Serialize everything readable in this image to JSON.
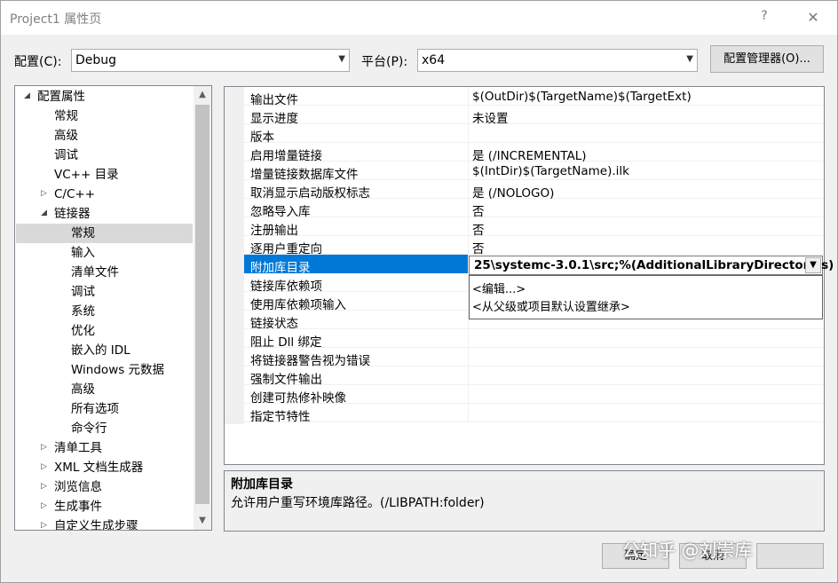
{
  "window": {
    "title": "Project1 属性页",
    "help_glyph": "?",
    "close_glyph": "✕"
  },
  "config": {
    "label": "配置(C):",
    "value": "Debug"
  },
  "platform": {
    "label": "平台(P):",
    "value": "x64"
  },
  "buttons": {
    "config_manager": "配置管理器(O)...",
    "ok": "确定",
    "cancel": "取消"
  },
  "tree": [
    {
      "label": "配置属性",
      "expander": "expanded"
    },
    {
      "label": "常规"
    },
    {
      "label": "高级"
    },
    {
      "label": "调试"
    },
    {
      "label": "VC++ 目录"
    },
    {
      "label": "C/C++",
      "expander": "collapsed"
    },
    {
      "label": "链接器",
      "expander": "expanded"
    },
    {
      "label": "常规",
      "selected": true
    },
    {
      "label": "输入"
    },
    {
      "label": "清单文件"
    },
    {
      "label": "调试"
    },
    {
      "label": "系统"
    },
    {
      "label": "优化"
    },
    {
      "label": "嵌入的 IDL"
    },
    {
      "label": "Windows 元数据"
    },
    {
      "label": "高级"
    },
    {
      "label": "所有选项"
    },
    {
      "label": "命令行"
    },
    {
      "label": "清单工具",
      "expander": "collapsed"
    },
    {
      "label": "XML 文档生成器",
      "expander": "collapsed"
    },
    {
      "label": "浏览信息",
      "expander": "collapsed"
    },
    {
      "label": "生成事件",
      "expander": "collapsed"
    },
    {
      "label": "自定义生成步骤",
      "expander": "collapsed"
    }
  ],
  "properties": [
    {
      "name": "输出文件",
      "value": "$(OutDir)$(TargetName)$(TargetExt)"
    },
    {
      "name": "显示进度",
      "value": "未设置"
    },
    {
      "name": "版本",
      "value": ""
    },
    {
      "name": "启用增量链接",
      "value": "是 (/INCREMENTAL)"
    },
    {
      "name": "增量链接数据库文件",
      "value": "$(IntDir)$(TargetName).ilk"
    },
    {
      "name": "取消显示启动版权标志",
      "value": "是 (/NOLOGO)"
    },
    {
      "name": "忽略导入库",
      "value": "否"
    },
    {
      "name": "注册输出",
      "value": "否"
    },
    {
      "name": "逐用户重定向",
      "value": "否"
    },
    {
      "name": "附加库目录",
      "value": "",
      "selected": true
    },
    {
      "name": "链接库依赖项",
      "value": ""
    },
    {
      "name": "使用库依赖项输入",
      "value": ""
    },
    {
      "name": "链接状态",
      "value": ""
    },
    {
      "name": "阻止 Dll 绑定",
      "value": ""
    },
    {
      "name": "将链接器警告视为错误",
      "value": ""
    },
    {
      "name": "强制文件输出",
      "value": ""
    },
    {
      "name": "创建可热修补映像",
      "value": ""
    },
    {
      "name": "指定节特性",
      "value": ""
    }
  ],
  "editor": {
    "value": "25\\systemc-3.0.1\\src;%(AdditionalLibraryDirectories)",
    "dropdown": [
      "<编辑...>",
      "<从父级或项目默认设置继承>"
    ]
  },
  "description": {
    "title": "附加库目录",
    "text": "允许用户重写环境库路径。(/LIBPATH:folder)"
  },
  "watermark": "公知乎 @刘崇库"
}
